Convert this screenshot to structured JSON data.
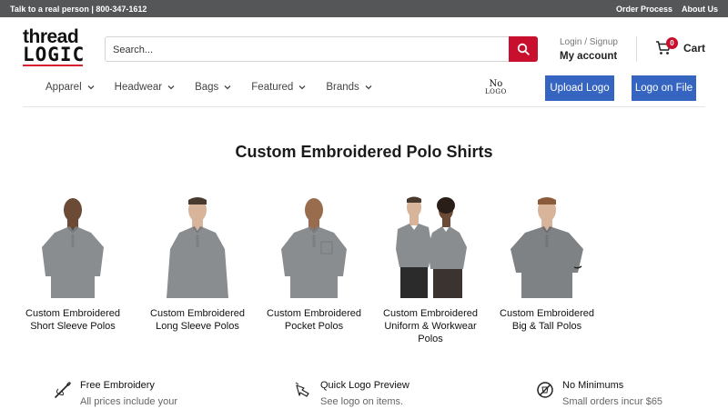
{
  "topbar": {
    "phone_text": "Talk to a real person | 800-347-1612",
    "links": [
      "Order Process",
      "About Us"
    ]
  },
  "header": {
    "logo_line1": "thread",
    "logo_line2": "LOGIC",
    "search_placeholder": "Search...",
    "login_label": "Login / Signup",
    "account_label": "My account",
    "cart_count": "0",
    "cart_label": "Cart"
  },
  "nav": {
    "items": [
      "Apparel",
      "Headwear",
      "Bags",
      "Featured",
      "Brands"
    ],
    "nologo_line1": "No",
    "nologo_line2": "LOGO",
    "upload_button": "Upload Logo",
    "logo_on_file_button": "Logo on File"
  },
  "main": {
    "title": "Custom Embroidered Polo Shirts",
    "products": [
      {
        "line1": "Custom Embroidered",
        "line2": "Short Sleeve Polos",
        "line3": ""
      },
      {
        "line1": "Custom Embroidered",
        "line2": "Long Sleeve Polos",
        "line3": ""
      },
      {
        "line1": "Custom Embroidered",
        "line2": "Pocket Polos",
        "line3": ""
      },
      {
        "line1": "Custom Embroidered",
        "line2": "Uniform & Workwear",
        "line3": "Polos"
      },
      {
        "line1": "Custom Embroidered",
        "line2": "Big & Tall Polos",
        "line3": ""
      }
    ]
  },
  "features": [
    {
      "title": "Free Embroidery",
      "subtitle": "All prices include your",
      "icon": "needle-icon"
    },
    {
      "title": "Quick Logo Preview",
      "subtitle": "See logo on items.",
      "icon": "hand-pointer-icon"
    },
    {
      "title": "No Minimums",
      "subtitle": "Small orders incur $65",
      "icon": "no-minimum-icon"
    }
  ],
  "colors": {
    "topbar": "#555658",
    "accent_red": "#c8102e",
    "button_blue": "#3565c0",
    "polo_gray": "#8a8d8f"
  }
}
